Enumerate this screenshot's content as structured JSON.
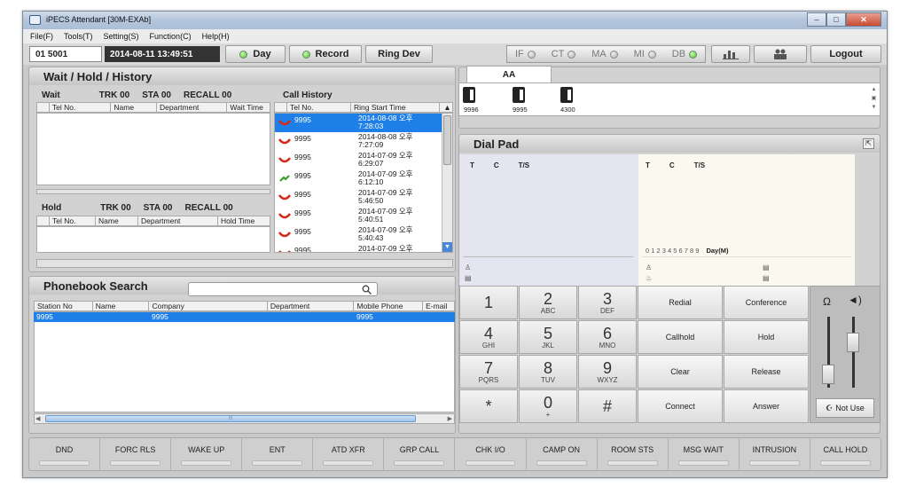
{
  "window": {
    "title": "iPECS Attendant [30M-EXAb]"
  },
  "menu": [
    "File(F)",
    "Tools(T)",
    "Setting(S)",
    "Function(C)",
    "Help(H)"
  ],
  "toolbar": {
    "station": "01  5001",
    "datetime": "2014-08-11 13:49:51",
    "day_label": "Day",
    "record_label": "Record",
    "ringdev_label": "Ring Dev",
    "indicators": [
      {
        "label": "IF",
        "status": "off"
      },
      {
        "label": "CT",
        "status": "off"
      },
      {
        "label": "MA",
        "status": "off"
      },
      {
        "label": "MI",
        "status": "off"
      },
      {
        "label": "DB",
        "status": "on"
      }
    ],
    "logout_label": "Logout"
  },
  "wait_hold": {
    "title": "Wait / Hold / History",
    "wait": {
      "label": "Wait",
      "trk": "TRK 00",
      "sta": "STA 00",
      "recall": "RECALL 00"
    },
    "hold": {
      "label": "Hold",
      "trk": "TRK 00",
      "sta": "STA 00",
      "recall": "RECALL 00"
    },
    "wait_columns": [
      "Tel No.",
      "Name",
      "Department",
      "Wait Time"
    ],
    "hold_columns": [
      "Tel No.",
      "Name",
      "Department",
      "Hold Time"
    ],
    "call_history": {
      "label": "Call History",
      "columns": [
        "Tel No.",
        "Ring Start Time"
      ],
      "rows": [
        {
          "tel": "9995",
          "date": "2014-08-08 오후",
          "time": "7:28:03",
          "type": "missed",
          "selected": true
        },
        {
          "tel": "9995",
          "date": "2014-08-08 오후",
          "time": "7:27:09",
          "type": "missed",
          "selected": false
        },
        {
          "tel": "9995",
          "date": "2014-07-09 오후",
          "time": "6:29:07",
          "type": "missed",
          "selected": false
        },
        {
          "tel": "9995",
          "date": "2014-07-09 오후",
          "time": "6:12:10",
          "type": "answered",
          "selected": false
        },
        {
          "tel": "9995",
          "date": "2014-07-09 오후",
          "time": "5:46:50",
          "type": "missed",
          "selected": false
        },
        {
          "tel": "9995",
          "date": "2014-07-09 오후",
          "time": "5:40:51",
          "type": "missed",
          "selected": false
        },
        {
          "tel": "9995",
          "date": "2014-07-09 오후",
          "time": "5:40:43",
          "type": "missed",
          "selected": false
        },
        {
          "tel": "9995",
          "date": "2014-07-09 오후",
          "time": "",
          "type": "missed",
          "selected": false
        }
      ]
    }
  },
  "phonebook": {
    "title": "Phonebook Search",
    "search_placeholder": "",
    "columns": [
      "Station No",
      "Name",
      "Company",
      "Department",
      "Mobile Phone",
      "E-mail"
    ],
    "rows": [
      {
        "station": "9995",
        "name": "",
        "company": "9995",
        "department": "",
        "mobile": "9995",
        "email": ""
      }
    ],
    "hscroll_grip": "III"
  },
  "extensions": {
    "tab": "AA",
    "items": [
      "9996",
      "9995",
      "4300"
    ]
  },
  "dialpad": {
    "title": "Dial Pad",
    "left_header": [
      "T",
      "C",
      "T/S"
    ],
    "right_header": [
      "T",
      "C",
      "T/S"
    ],
    "digits_row": "0  1  2  3  4  5  6  7  8  9",
    "day_mode": "Day(M)",
    "keys": [
      {
        "d": "1",
        "l": ""
      },
      {
        "d": "2",
        "l": "ABC"
      },
      {
        "d": "3",
        "l": "DEF"
      },
      {
        "d": "4",
        "l": "GHI"
      },
      {
        "d": "5",
        "l": "JKL"
      },
      {
        "d": "6",
        "l": "MNO"
      },
      {
        "d": "7",
        "l": "PQRS"
      },
      {
        "d": "8",
        "l": "TUV"
      },
      {
        "d": "9",
        "l": "WXYZ"
      },
      {
        "d": "*",
        "l": ""
      },
      {
        "d": "0",
        "l": "+"
      },
      {
        "d": "#",
        "l": ""
      }
    ],
    "functions": [
      "Redial",
      "Conference",
      "Callhold",
      "Hold",
      "Clear",
      "Release",
      "Connect",
      "Answer"
    ],
    "not_use_label": "Not Use"
  },
  "bottom_buttons": [
    "DND",
    "FORC RLS",
    "WAKE UP",
    "ENT",
    "ATD XFR",
    "GRP CALL",
    "CHK I/O",
    "CAMP ON",
    "ROOM STS",
    "MSG WAIT",
    "INTRUSION",
    "CALL HOLD"
  ],
  "colors": {
    "selection": "#1e7fe8",
    "missed": "#d42a1a",
    "answered": "#3aa02a",
    "indicator_on": "#4cbb2a"
  }
}
